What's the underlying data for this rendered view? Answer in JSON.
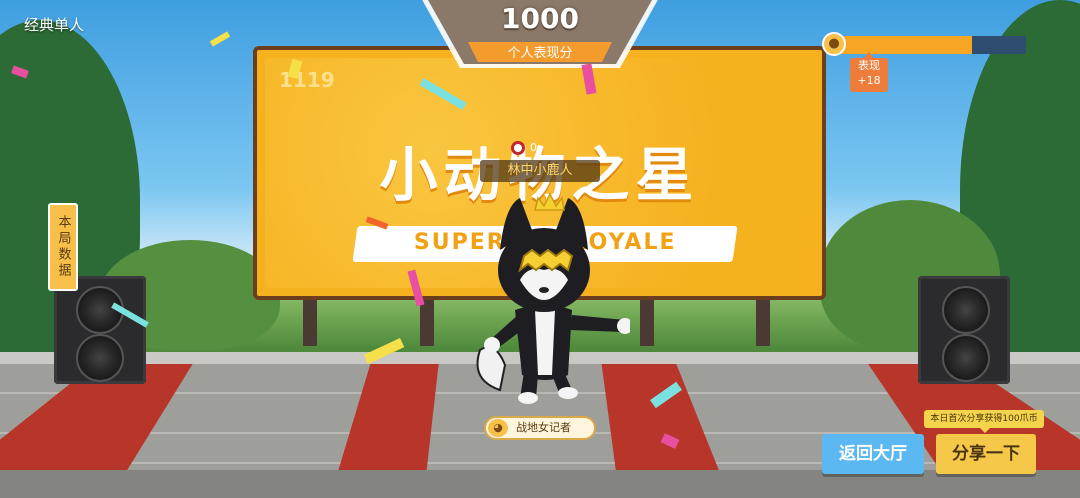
{
  "mode_label": "经典单人",
  "score": {
    "value": "1000",
    "label": "个人表现分"
  },
  "billboard": {
    "code": "1119",
    "title": "小动物之星",
    "subtitle": "SUPER A    L ROYALE"
  },
  "performance": {
    "progress": 0.72,
    "tip_label": "表现",
    "tip_value": "+18"
  },
  "round_data_tab": "本局数据",
  "player": {
    "badge_count": "0",
    "name": "林中小鹿人",
    "title": "战地女记者"
  },
  "share_hint": "本日首次分享获得100爪币",
  "buttons": {
    "back": "返回大厅",
    "share": "分享一下"
  },
  "colors": {
    "board": "#f6b11f",
    "back_button": "#5bb8f0",
    "share_button": "#f6c84a",
    "progress_fill": "#f6a623",
    "carpet": "#b8352a"
  },
  "icons": {
    "paw": "paw-icon",
    "player_badge": "skull-badge-icon",
    "title_cat": "cat-face-icon"
  }
}
